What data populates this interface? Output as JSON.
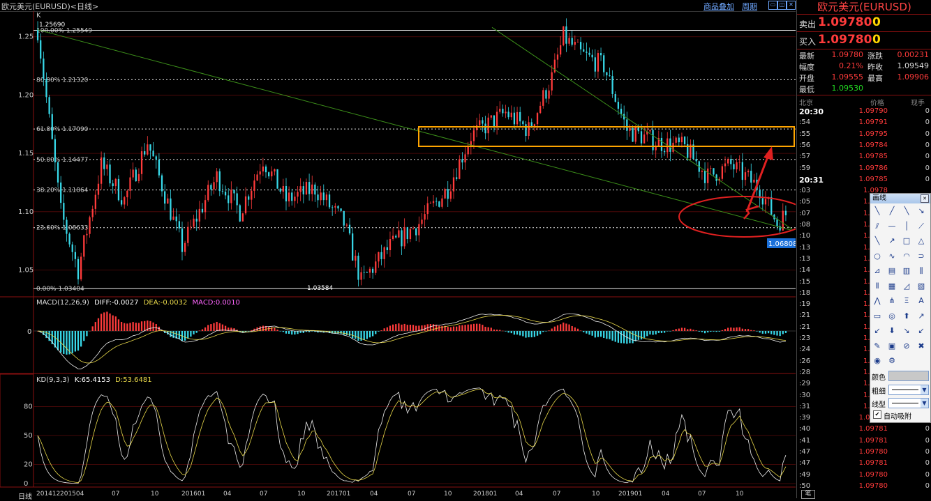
{
  "window": {
    "title": "欧元美元(EURUSD)<日线>",
    "link_overlay": "商品叠加",
    "link_period": "周期",
    "btn_minimize": "▭",
    "btn_restore": "◫",
    "btn_close": "✕"
  },
  "main_chart": {
    "k_label": "K",
    "y_ticks": [
      "1.25",
      "1.20",
      "1.15",
      "1.10",
      "1.05"
    ],
    "high_label": "1.25690",
    "low_label": "1.03584",
    "fib_levels": [
      {
        "label": "100.00% 1.25549",
        "price": 1.25549,
        "style": "solid"
      },
      {
        "label": "80.90% 1.21320",
        "price": 1.2132,
        "style": "dotted"
      },
      {
        "label": "61.80% 1.17090",
        "price": 1.1709,
        "style": "dotted"
      },
      {
        "label": "50.00% 1.14477",
        "price": 1.14477,
        "style": "dotted"
      },
      {
        "label": "38.20% 1.11864",
        "price": 1.11864,
        "style": "dotted"
      },
      {
        "label": "23.60% 1.08633",
        "price": 1.08633,
        "style": "dotted"
      },
      {
        "label": "0.00% 1.03404",
        "price": 1.03404,
        "style": "solid"
      }
    ],
    "current_price_label": "1.06808",
    "colors": {
      "up": "#ff3b3b",
      "down": "#38d8e8",
      "trend": "#3c8f1a",
      "box": "#ffa500",
      "circle": "#e02020"
    }
  },
  "macd": {
    "label": "MACD(12,26,9)",
    "diff": "DIFF:-0.0027",
    "dea": "DEA:-0.0032",
    "macd": "MACD:0.0010",
    "zero_label": "0"
  },
  "kd": {
    "label": "KD(9,3,3)",
    "k": "K:65.4153",
    "d": "D:53.6481",
    "y_ticks": [
      "80",
      "50",
      "20",
      "0"
    ]
  },
  "x_axis": {
    "period_tab": "日线",
    "labels": [
      "201412",
      "201504",
      "07",
      "10",
      "201601",
      "04",
      "07",
      "10",
      "201701",
      "04",
      "07",
      "10",
      "201801",
      "04",
      "07",
      "10",
      "201901",
      "04",
      "07",
      "10"
    ]
  },
  "quote_panel": {
    "title": "欧元美元(EURUSD)",
    "sell_label": "卖出",
    "sell_price": "1.09780",
    "sell_vol": "0",
    "buy_label": "买入",
    "buy_price": "1.09780",
    "buy_vol": "0",
    "stats": [
      {
        "l1": "最新",
        "v1": "1.09780",
        "c1": "#ff3b3b",
        "l2": "涨跌",
        "v2": "0.00231",
        "c2": "#ff3b3b"
      },
      {
        "l1": "幅度",
        "v1": "0.21%",
        "c1": "#ff3b3b",
        "l2": "昨收",
        "v2": "1.09549",
        "c2": "#dddddd"
      },
      {
        "l1": "开盘",
        "v1": "1.09555",
        "c1": "#ff3b3b",
        "l2": "最高",
        "v2": "1.09906",
        "c2": "#ff3b3b"
      },
      {
        "l1": "最低",
        "v1": "1.09530",
        "c1": "#22dd22",
        "l2": "",
        "v2": "",
        "c2": "#dddddd"
      }
    ],
    "tick_header": {
      "time": "北京",
      "price": "价格",
      "vol": "现手"
    },
    "ticks": [
      {
        "t": "20:30",
        "p": "1.09790",
        "v": "0",
        "bold": true
      },
      {
        "t": ":54",
        "p": "1.09791",
        "v": "0"
      },
      {
        "t": ":55",
        "p": "1.09795",
        "v": "0"
      },
      {
        "t": ":56",
        "p": "1.09784",
        "v": "0"
      },
      {
        "t": ":57",
        "p": "1.09785",
        "v": "0"
      },
      {
        "t": ":59",
        "p": "1.09786",
        "v": "0"
      },
      {
        "t": "20:31",
        "p": "1.09785",
        "v": "0",
        "bold": true
      },
      {
        "t": ":03",
        "p": "1.0978",
        "v": ""
      },
      {
        "t": ":05",
        "p": "1.0978",
        "v": ""
      },
      {
        "t": ":07",
        "p": "1.0978",
        "v": ""
      },
      {
        "t": ":08",
        "p": "1.0978",
        "v": ""
      },
      {
        "t": ":10",
        "p": "1.0978",
        "v": ""
      },
      {
        "t": ":13",
        "p": "1.0978",
        "v": ""
      },
      {
        "t": ":13",
        "p": "1.0978",
        "v": ""
      },
      {
        "t": ":14",
        "p": "1.0978",
        "v": ""
      },
      {
        "t": ":15",
        "p": "1.0978",
        "v": ""
      },
      {
        "t": ":18",
        "p": "1.0978",
        "v": ""
      },
      {
        "t": ":19",
        "p": "1.0979",
        "v": ""
      },
      {
        "t": ":21",
        "p": "1.0979",
        "v": ""
      },
      {
        "t": ":21",
        "p": "1.0979",
        "v": ""
      },
      {
        "t": ":23",
        "p": "1.0979",
        "v": ""
      },
      {
        "t": ":24",
        "p": "1.0979",
        "v": ""
      },
      {
        "t": ":26",
        "p": "1.0979",
        "v": ""
      },
      {
        "t": ":28",
        "p": "1.0978",
        "v": ""
      },
      {
        "t": ":29",
        "p": "1.0978",
        "v": ""
      },
      {
        "t": ":30",
        "p": "1.0978",
        "v": ""
      },
      {
        "t": ":31",
        "p": "1.0978",
        "v": ""
      },
      {
        "t": ":39",
        "p": "1.09780",
        "v": "0"
      },
      {
        "t": ":40",
        "p": "1.09781",
        "v": "0"
      },
      {
        "t": ":41",
        "p": "1.09781",
        "v": "0"
      },
      {
        "t": ":47",
        "p": "1.09780",
        "v": "0"
      },
      {
        "t": ":47",
        "p": "1.09781",
        "v": "0"
      },
      {
        "t": ":49",
        "p": "1.09780",
        "v": "0"
      },
      {
        "t": ":50",
        "p": "1.09780",
        "v": "0"
      }
    ],
    "bottom_tab": "笔"
  },
  "draw_tool": {
    "title": "画线",
    "close": "✕",
    "icons": [
      {
        "n": "segment-icon",
        "g": "╲"
      },
      {
        "n": "ray-up-icon",
        "g": "╱"
      },
      {
        "n": "line-icon",
        "g": "╲"
      },
      {
        "n": "arrow-line-icon",
        "g": "↘"
      },
      {
        "n": "parallel-icon",
        "g": "⫽"
      },
      {
        "n": "horizontal-line-icon",
        "g": "—"
      },
      {
        "n": "vertical-line-icon",
        "g": "│"
      },
      {
        "n": "fan-line-icon",
        "g": "⟋"
      },
      {
        "n": "diagonal-icon",
        "g": "╲"
      },
      {
        "n": "arrow-up-right-icon",
        "g": "↗"
      },
      {
        "n": "rectangle-icon",
        "g": "□"
      },
      {
        "n": "triangle-icon",
        "g": "△"
      },
      {
        "n": "ellipse-icon",
        "g": "○"
      },
      {
        "n": "wave-icon",
        "g": "∿"
      },
      {
        "n": "arc-icon",
        "g": "◠"
      },
      {
        "n": "curve-icon",
        "g": "⊃"
      },
      {
        "n": "fibonacci-icon",
        "g": "⊿"
      },
      {
        "n": "gann-icon",
        "g": "▤"
      },
      {
        "n": "channel-icon",
        "g": "▥"
      },
      {
        "n": "cycle-icon",
        "g": "⫼"
      },
      {
        "n": "period-line-icon",
        "g": "⦀"
      },
      {
        "n": "grid-lines-icon",
        "g": "▦"
      },
      {
        "n": "speed-line-icon",
        "g": "◿"
      },
      {
        "n": "percent-line-icon",
        "g": "▧"
      },
      {
        "n": "wedge-icon",
        "g": "⋀"
      },
      {
        "n": "fork-icon",
        "g": "⋔"
      },
      {
        "n": "gann-fan-icon",
        "g": "Ξ"
      },
      {
        "n": "text-icon",
        "g": "A"
      },
      {
        "n": "ruler-icon",
        "g": "▭"
      },
      {
        "n": "target-icon",
        "g": "◎"
      },
      {
        "n": "up-marker-icon",
        "g": "⬆"
      },
      {
        "n": "arrow-red-icon",
        "g": "↗"
      },
      {
        "n": "arrow-down-left-icon",
        "g": "↙"
      },
      {
        "n": "down-marker-icon",
        "g": "⬇"
      },
      {
        "n": "arrow-green-icon",
        "g": "↘"
      },
      {
        "n": "arrow-green2-icon",
        "g": "↙"
      },
      {
        "n": "pencil-icon",
        "g": "✎"
      },
      {
        "n": "palette-icon",
        "g": "▣"
      },
      {
        "n": "hide-icon",
        "g": "⊘"
      },
      {
        "n": "delete-icon",
        "g": "✖"
      },
      {
        "n": "eye-icon",
        "g": "◉"
      },
      {
        "n": "gear-icon",
        "g": "⚙"
      }
    ],
    "color_label": "颜色",
    "width_label": "粗细",
    "style_label": "线型",
    "auto_snap_label": "自动吸附",
    "check": "✔"
  }
}
